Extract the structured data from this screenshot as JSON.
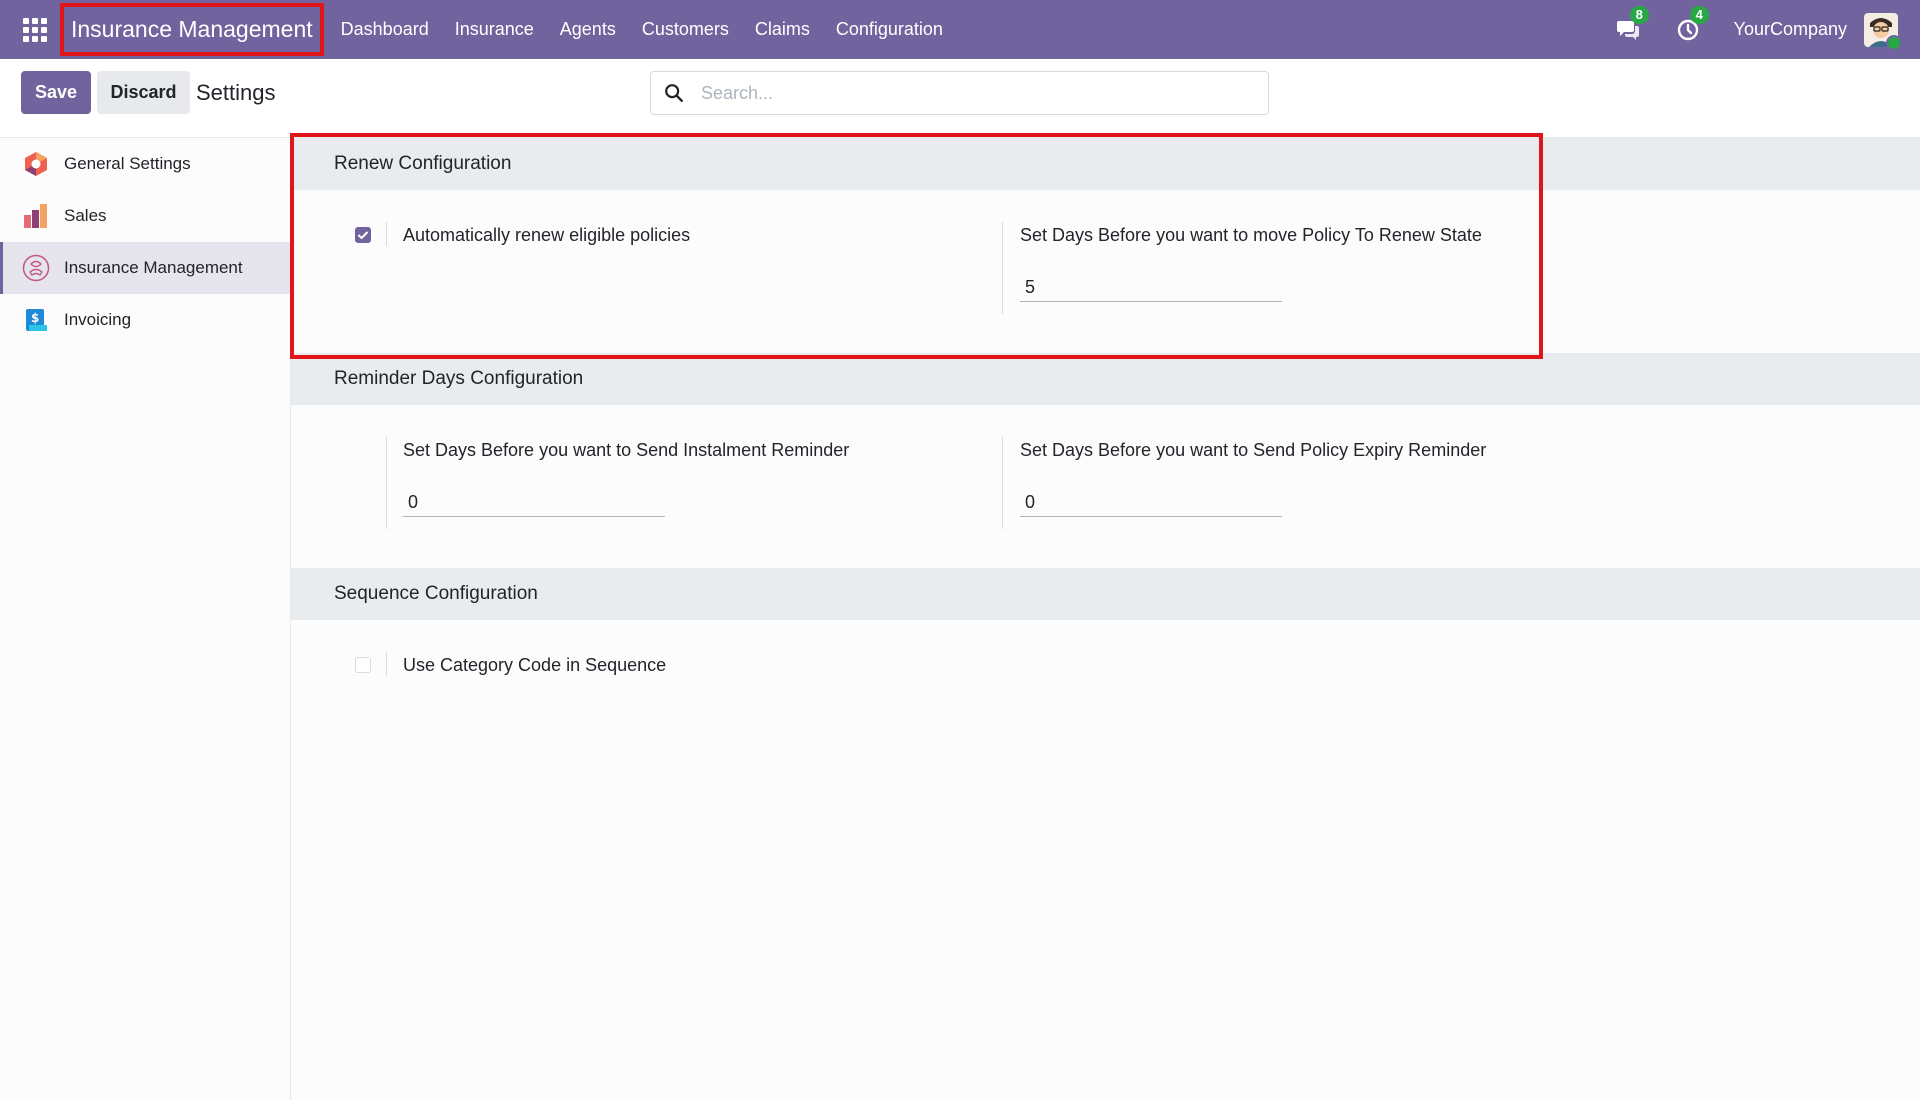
{
  "navbar": {
    "app_name": "Insurance Management",
    "menu": [
      "Dashboard",
      "Insurance",
      "Agents",
      "Customers",
      "Claims",
      "Configuration"
    ],
    "messages_count": "8",
    "activities_count": "4",
    "company": "YourCompany",
    "brand_color": "#71639e",
    "badge_color": "#28a745"
  },
  "control": {
    "save_label": "Save",
    "discard_label": "Discard",
    "title": "Settings",
    "search_placeholder": "Search..."
  },
  "sidebar": {
    "items": [
      {
        "label": "General Settings",
        "icon": "general-settings-icon"
      },
      {
        "label": "Sales",
        "icon": "sales-icon"
      },
      {
        "label": "Insurance Management",
        "icon": "insurance-icon",
        "active": true
      },
      {
        "label": "Invoicing",
        "icon": "invoicing-icon"
      }
    ]
  },
  "sections": {
    "renew": {
      "title": "Renew Configuration",
      "auto_renew_label": "Automatically renew eligible policies",
      "auto_renew_checked": true,
      "renew_days_label": "Set Days Before you want to move Policy To Renew State",
      "renew_days_value": "5"
    },
    "reminder": {
      "title": "Reminder Days Configuration",
      "instalment_label": "Set Days Before you want to Send Instalment Reminder",
      "instalment_value": "0",
      "expiry_label": "Set Days Before you want to Send Policy Expiry Reminder",
      "expiry_value": "0"
    },
    "sequence": {
      "title": "Sequence Configuration",
      "category_code_label": "Use Category Code in Sequence",
      "category_code_checked": false
    }
  },
  "highlight_color": "#e0151a"
}
